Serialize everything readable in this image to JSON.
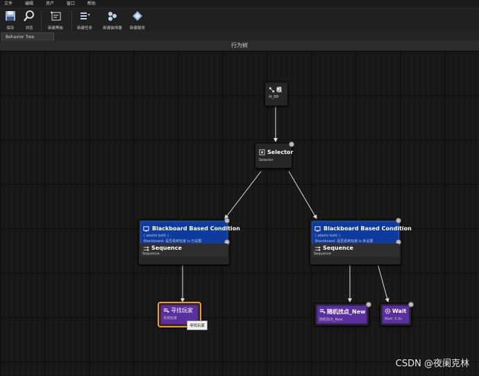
{
  "menu": [
    "文件",
    "编辑",
    "资产",
    "窗口",
    "帮助"
  ],
  "toolbar": {
    "save": "保存",
    "browse": "浏览",
    "new_blackboard": "新建黑板",
    "new_task": "新建任务",
    "new_decorator": "新建装饰器",
    "new_service": "新建服务"
  },
  "tab_label": "Behavior Tree",
  "graph_title": "行为树",
  "nodes": {
    "root": {
      "title": "根",
      "sub": "AI_BB"
    },
    "selector": {
      "title": "Selector",
      "sub": "Selector"
    },
    "left": {
      "deco_title": "Blackboard Based Condition",
      "deco_line1": "( aborts both )",
      "deco_line2": "Blackboard: 是否看到玩家 is 已设置",
      "seq_title": "Sequence",
      "seq_sub": "Sequence"
    },
    "right": {
      "deco_title": "Blackboard Based Condition",
      "deco_line1": "( aborts both )",
      "deco_line2": "Blackboard: 是否看到玩家 is 未设置",
      "seq_title": "Sequence",
      "seq_sub": "Sequence"
    },
    "find_player": {
      "title": "寻找玩家",
      "sub": "寻找玩家"
    },
    "random_point": {
      "title": "随机找点_New",
      "sub": "随机找点_New"
    },
    "wait": {
      "title": "Wait",
      "sub": "Wait: 5.0s"
    }
  },
  "tooltip": "寻找玩家",
  "watermark": "CSDN @夜阑克林",
  "colors": {
    "decorator": "#0e3b9e",
    "task": "#5a2f9f",
    "selected": "#f0a020"
  }
}
